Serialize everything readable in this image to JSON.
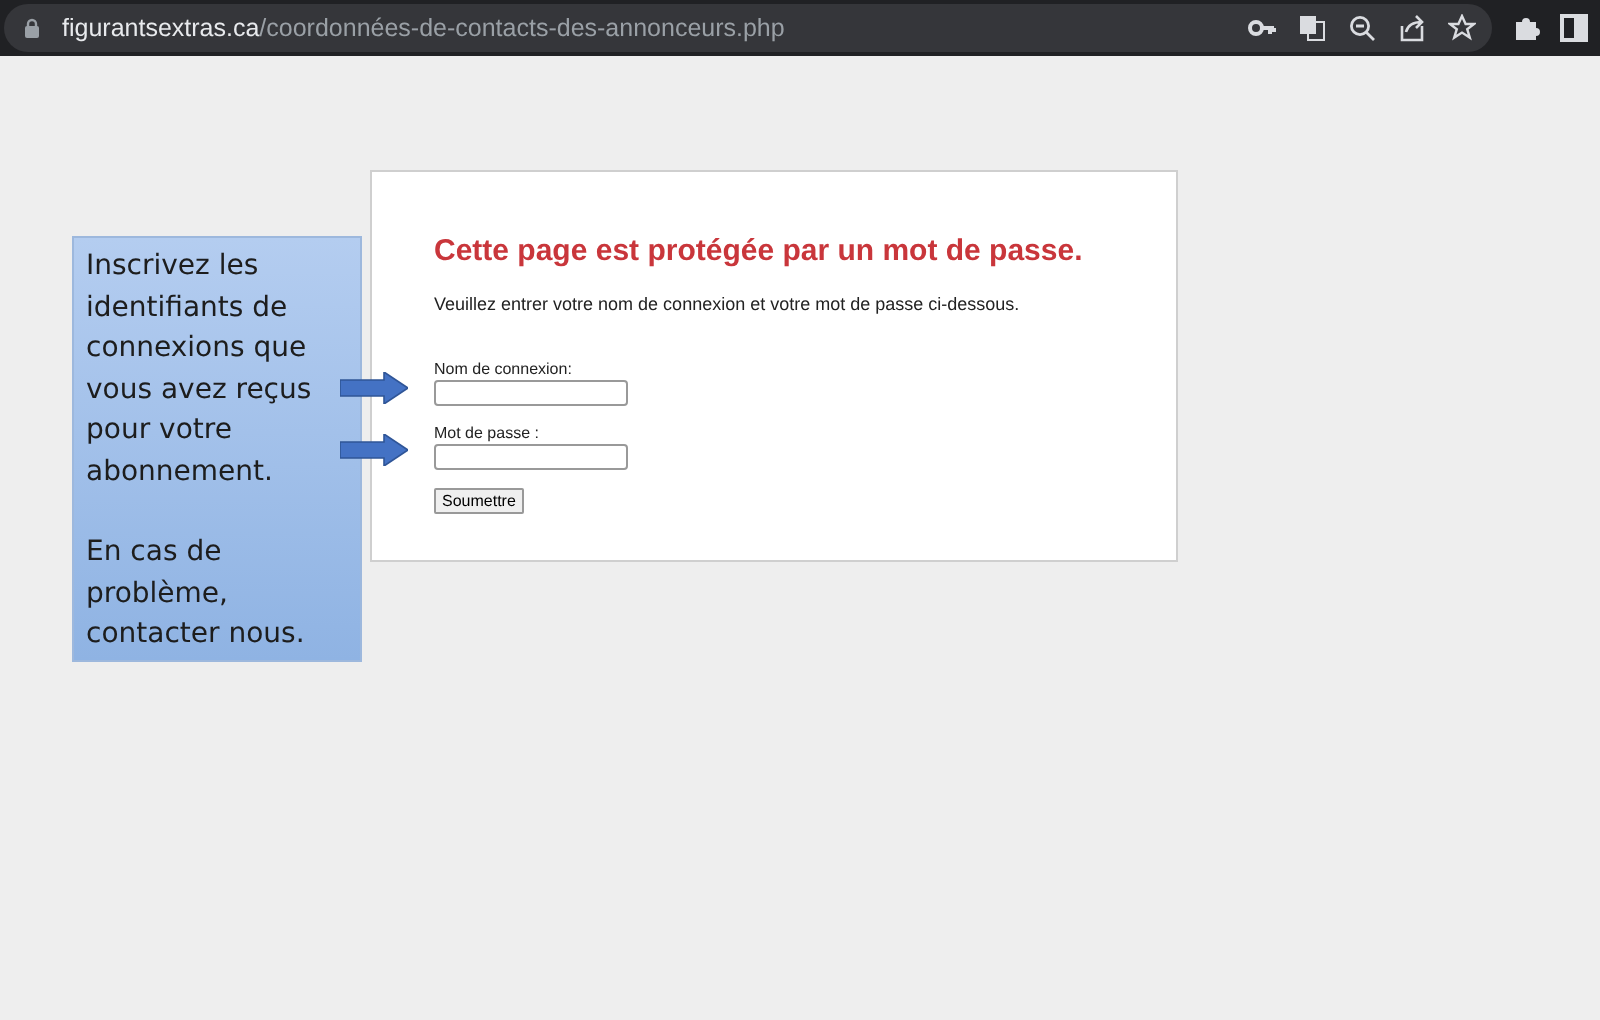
{
  "browser": {
    "url_host": "figurantsextras.ca",
    "url_path": "/coordonnées-de-contacts-des-annonceurs.php"
  },
  "login": {
    "title": "Cette page est protégée par un mot de passe.",
    "instructions": "Veuillez entrer votre nom de connexion et votre mot de passe ci-dessous.",
    "fields": [
      {
        "label": "Nom de connexion:"
      },
      {
        "label": "Mot de passe :"
      }
    ],
    "submit": "Soumettre"
  },
  "callout": {
    "paragraphs": [
      "Inscrivez les identifiants de connexions que vous avez reçus pour votre abonnement.",
      "En cas de problème, contacter nous."
    ]
  }
}
